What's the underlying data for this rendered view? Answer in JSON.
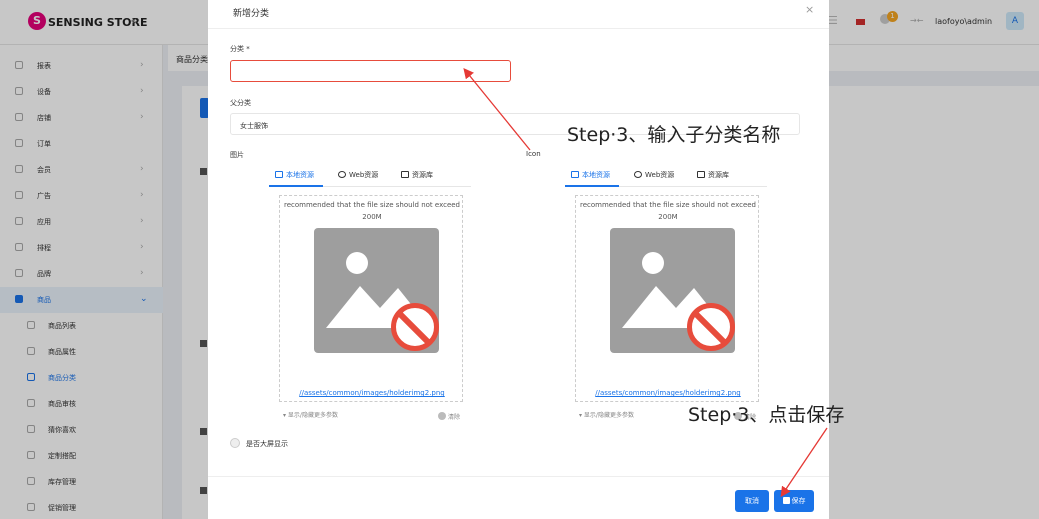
{
  "header": {
    "logo_letter": "S",
    "logo_text": "SENSING STORE",
    "collapse_glyph": "«",
    "menu_glyph": "☰",
    "badge": "1",
    "arrows": "→←",
    "user": "laofoyo\\admin",
    "avatar": "A"
  },
  "sidebar": {
    "items": [
      {
        "label": "报表",
        "icon": "report-icon",
        "chevron": "›"
      },
      {
        "label": "设备",
        "icon": "device-icon",
        "chevron": "›"
      },
      {
        "label": "店铺",
        "icon": "store-icon",
        "chevron": "›"
      },
      {
        "label": "订单",
        "icon": "order-icon",
        "chevron": ""
      },
      {
        "label": "会员",
        "icon": "member-icon",
        "chevron": "›"
      },
      {
        "label": "广告",
        "icon": "ad-icon",
        "chevron": "›"
      },
      {
        "label": "应用",
        "icon": "app-icon",
        "chevron": "›"
      },
      {
        "label": "排程",
        "icon": "schedule-icon",
        "chevron": "›"
      },
      {
        "label": "品牌",
        "icon": "brand-icon",
        "chevron": "›"
      },
      {
        "label": "商品",
        "icon": "goods-icon",
        "chevron": "⌄"
      }
    ],
    "sub_items": [
      {
        "label": "商品列表",
        "icon": "list-icon"
      },
      {
        "label": "商品属性",
        "icon": "attribute-icon"
      },
      {
        "label": "商品分类",
        "icon": "category-icon"
      },
      {
        "label": "商品审核",
        "icon": "review-icon"
      },
      {
        "label": "猜你喜欢",
        "icon": "heart-icon"
      },
      {
        "label": "定制搭配",
        "icon": "match-icon"
      },
      {
        "label": "库存管理",
        "icon": "stock-icon"
      },
      {
        "label": "促销管理",
        "icon": "promo-icon"
      }
    ]
  },
  "breadcrumb": {
    "text": "商品分类"
  },
  "modal": {
    "title": "新增分类",
    "close": "×",
    "category_label": "分类 *",
    "category_value": "",
    "parent_label": "父分类",
    "parent_value": "女士服饰",
    "image_label": "图片",
    "icon_label": "Icon",
    "tabs": [
      "本地资源",
      "Web资源",
      "资源库"
    ],
    "upload_note": "recommended that the file size should not exceed 200M",
    "image_path": "//assets/common/images/holderimg2.png",
    "more_params": "▾ 显示/隐藏更多参数",
    "clear": "清除",
    "big_screen_label": "是否大屏显示",
    "cancel": "取消",
    "save": "保存"
  },
  "annotations": {
    "step_input": "Step·3、输入子分类名称",
    "step_save": "Step·3、点击保存"
  }
}
